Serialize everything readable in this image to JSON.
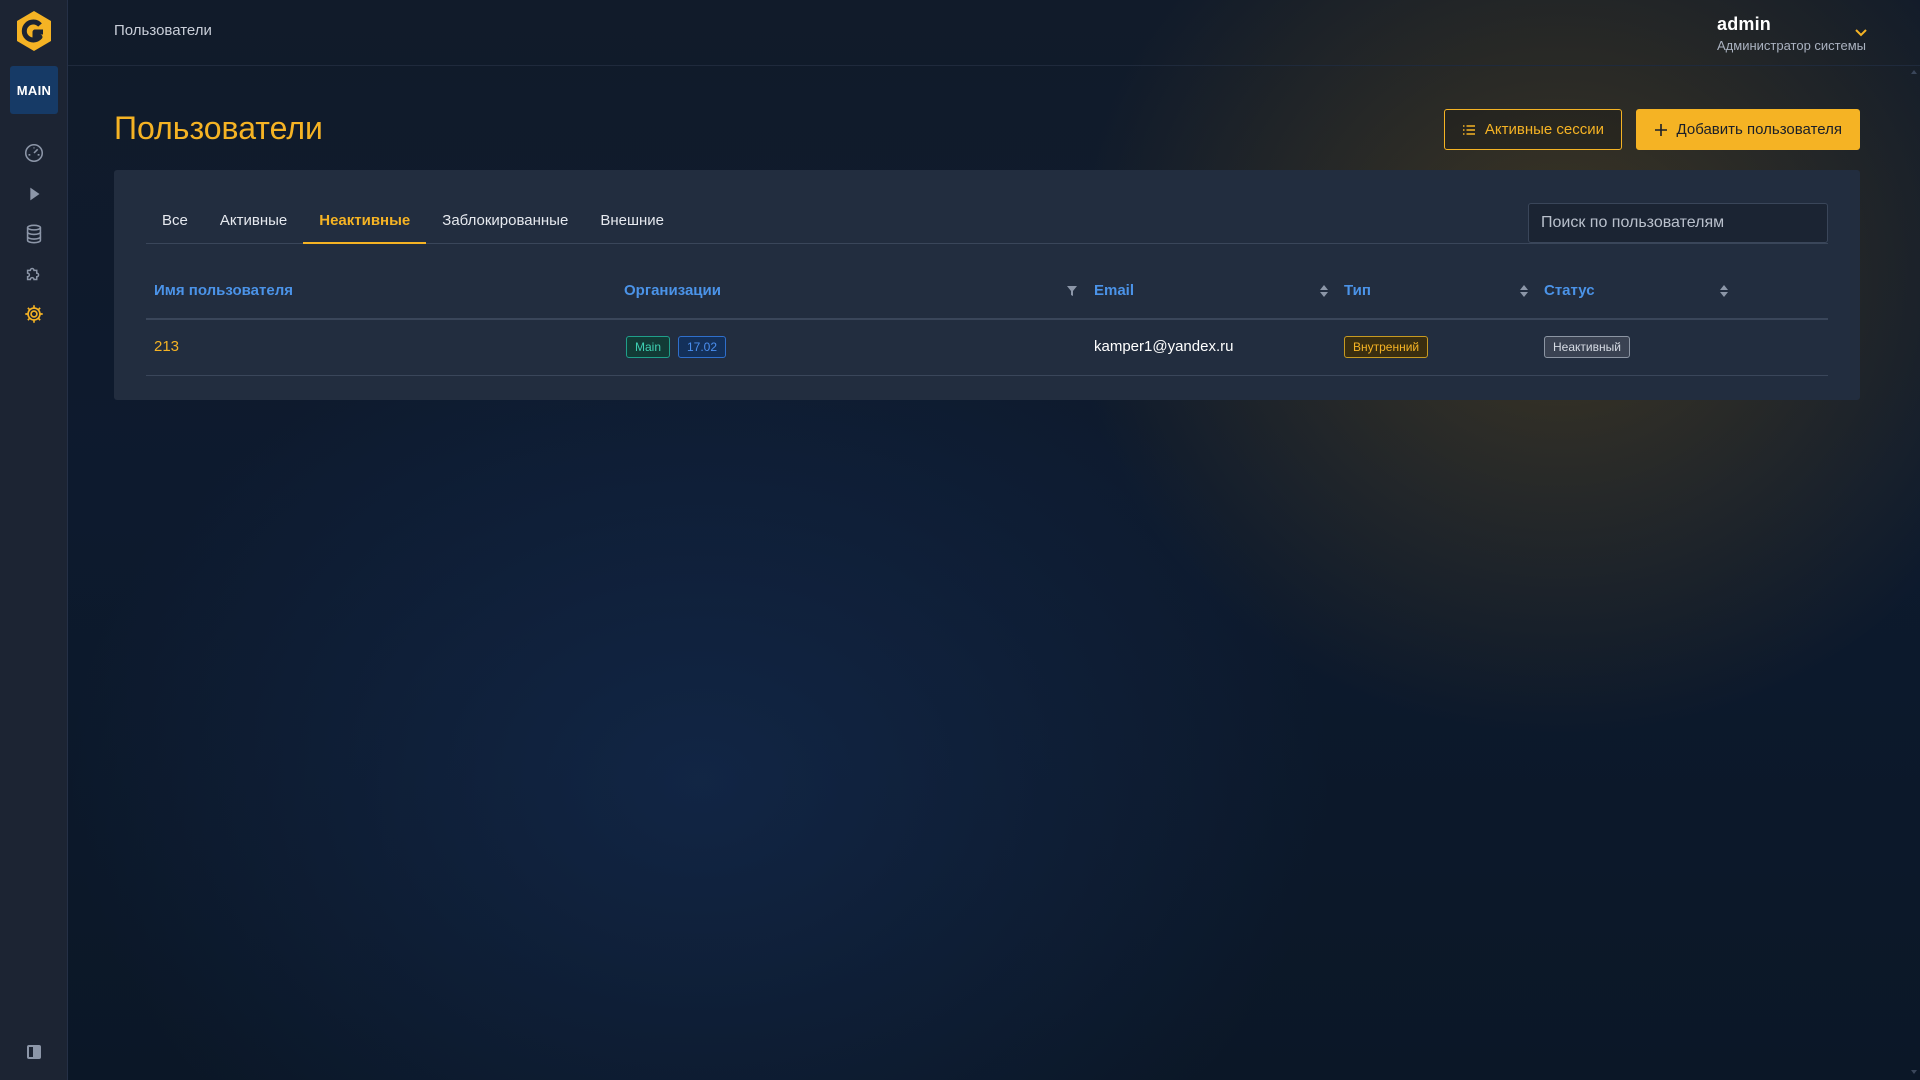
{
  "sidebar": {
    "workspace_badge": "MAIN",
    "items": [
      {
        "icon": "dashboard-gauge-icon"
      },
      {
        "icon": "play-icon"
      },
      {
        "icon": "database-icon"
      },
      {
        "icon": "puzzle-icon"
      },
      {
        "icon": "gear-icon",
        "active": true
      }
    ],
    "accent_color": "#f5b324"
  },
  "topbar": {
    "breadcrumb": "Пользователи",
    "user_name": "admin",
    "user_role": "Администратор системы"
  },
  "page": {
    "title": "Пользователи",
    "sessions_button": "Активные сессии",
    "add_button": "Добавить пользователя"
  },
  "tabs": [
    {
      "label": "Все",
      "active": false
    },
    {
      "label": "Активные",
      "active": false
    },
    {
      "label": "Неактивные",
      "active": true
    },
    {
      "label": "Заблокированные",
      "active": false
    },
    {
      "label": "Внешние",
      "active": false
    }
  ],
  "search": {
    "placeholder": "Поиск по пользователям"
  },
  "table": {
    "columns": {
      "username": "Имя пользователя",
      "organizations": "Организации",
      "email": "Email",
      "type": "Тип",
      "status": "Статус"
    },
    "rows": [
      {
        "username": "213",
        "org_tags": [
          "Main",
          "17.02"
        ],
        "email": "kamper1@yandex.ru",
        "type": "Внутренний",
        "status": "Неактивный"
      }
    ]
  }
}
